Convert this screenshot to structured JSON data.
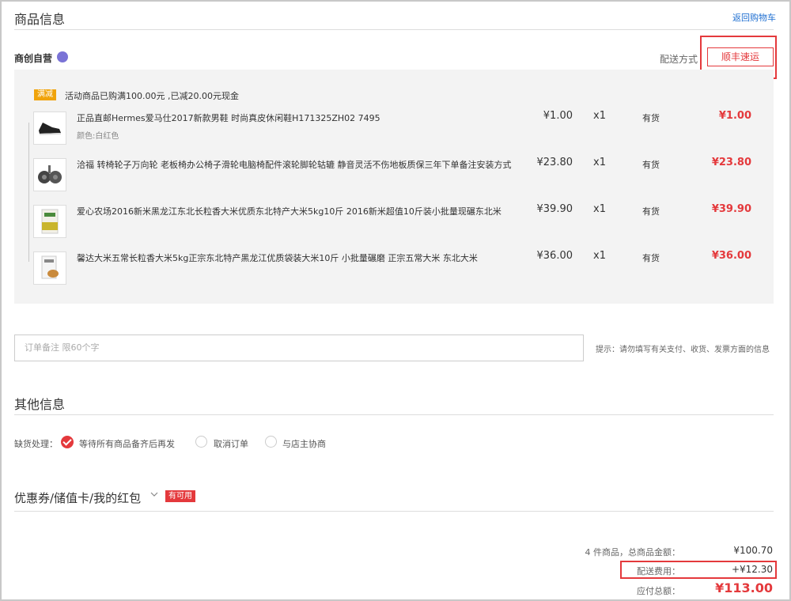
{
  "header": {
    "title": "商品信息",
    "back_link": "返回购物车"
  },
  "store": {
    "name": "商创自营",
    "shipping_label": "配送方式",
    "shipping_option": "顺丰速运"
  },
  "promo": {
    "tag": "满减",
    "text": "活动商品已购满100.00元 ,已减20.00元现金"
  },
  "items": [
    {
      "name": "正品直邮Hermes爱马仕2017新款男鞋 时尚真皮休闲鞋H171325ZH02 7495",
      "color": "颜色:白红色",
      "price": "¥1.00",
      "qty": "x1",
      "stock": "有货",
      "subtotal": "¥1.00",
      "icon": "shoe-icon"
    },
    {
      "name": "洽福 转椅轮子万向轮 老板椅办公椅子滑轮电脑椅配件滚轮脚轮轱辘 静音灵活不伤地板质保三年下单备注安装方式",
      "color": "",
      "price": "¥23.80",
      "qty": "x1",
      "stock": "有货",
      "subtotal": "¥23.80",
      "icon": "caster-wheel-icon"
    },
    {
      "name": "爱心农场2016新米黑龙江东北长粒香大米优质东北特产大米5kg10斤 2016新米超值10斤装小批量现碾东北米",
      "color": "",
      "price": "¥39.90",
      "qty": "x1",
      "stock": "有货",
      "subtotal": "¥39.90",
      "icon": "rice-bag-icon"
    },
    {
      "name": "馨达大米五常长粒香大米5kg正宗东北特产黑龙江优质袋装大米10斤 小批量碾磨 正宗五常大米 东北大米",
      "color": "",
      "price": "¥36.00",
      "qty": "x1",
      "stock": "有货",
      "subtotal": "¥36.00",
      "icon": "rice-bag-icon"
    }
  ],
  "remark": {
    "placeholder": "订单备注 限60个字",
    "tip": "提示：请勿填写有关支付、收货、发票方面的信息"
  },
  "other": {
    "title": "其他信息",
    "stockout_label": "缺货处理：",
    "options": [
      {
        "label": "等待所有商品备齐后再发",
        "selected": true
      },
      {
        "label": "取消订单",
        "selected": false
      },
      {
        "label": "与店主协商",
        "selected": false
      }
    ]
  },
  "coupon": {
    "title": "优惠券/储值卡/我的红包",
    "badge": "有可用"
  },
  "summary": {
    "goods_label": "4 件商品，总商品金额：",
    "goods_value": "¥100.70",
    "shipping_label": "配送费用：",
    "shipping_value": "+¥12.30",
    "total_label": "应付总额：",
    "total_value": "¥113.00"
  },
  "colors": {
    "accent": "#e4393c",
    "promo": "#f0a30a",
    "link": "#1f6fd1",
    "panel_bg": "#f3f3f3"
  }
}
